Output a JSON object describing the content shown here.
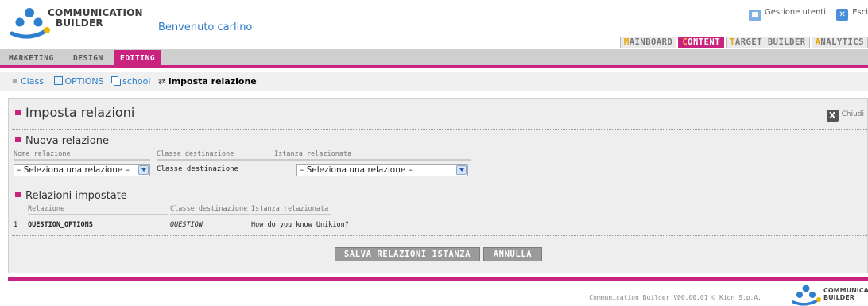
{
  "header": {
    "logo_line1": "COMMUNICATION",
    "logo_line2": "BUILDER",
    "welcome": "Benvenuto carlino",
    "user_links": {
      "users": "Gestione utenti",
      "exit": "Esci"
    },
    "main_tabs": [
      {
        "first": "M",
        "rest": "AINBOARD"
      },
      {
        "first": "C",
        "rest": "ONTENT"
      },
      {
        "first": "T",
        "rest": "ARGET BUILDER"
      },
      {
        "first": "A",
        "rest": "NALYTICS"
      }
    ],
    "active_main_tab": "CONTENT"
  },
  "sub_tabs": [
    "MARKETING",
    "DESIGN",
    "EDITING"
  ],
  "active_sub_tab": "EDITING",
  "breadcrumb": {
    "items": [
      "Classi",
      "OPTIONS",
      "school"
    ],
    "current": "Imposta relazione"
  },
  "panel": {
    "title": "Imposta relazioni",
    "close_label": "Chiudi",
    "new_relation": {
      "title": "Nuova relazione",
      "col_name": "Nome relazione",
      "col_dest": "Classe destinazione",
      "col_instance": "Istanza relazionata",
      "name_select_value": "– Seleziona una relazione –",
      "dest_value": "Classe destinazione",
      "instance_select_value": "– Seleziona una relazione –"
    },
    "set_relations": {
      "title": "Relazioni impostate",
      "headers": [
        "Relazione",
        "Classe destinazione",
        "Istanza relazionata"
      ],
      "rows": [
        {
          "num": "1",
          "relation": "QUESTION_OPTIONS",
          "dest": "QUESTION",
          "instance": "How do you know Unikion?"
        }
      ]
    },
    "buttons": {
      "save": "SALVA RELAZIONI ISTANZA",
      "cancel": "ANNULLA"
    }
  },
  "footer": {
    "text": "Communication Builder V00.00.01 © Kion S.p.A.",
    "logo_line1": "COMMUNICATION",
    "logo_line2": "BUILDER"
  },
  "colors": {
    "accent": "#c9237f",
    "link": "#2b7dc7",
    "tab_first_letter": "#e9a200"
  }
}
